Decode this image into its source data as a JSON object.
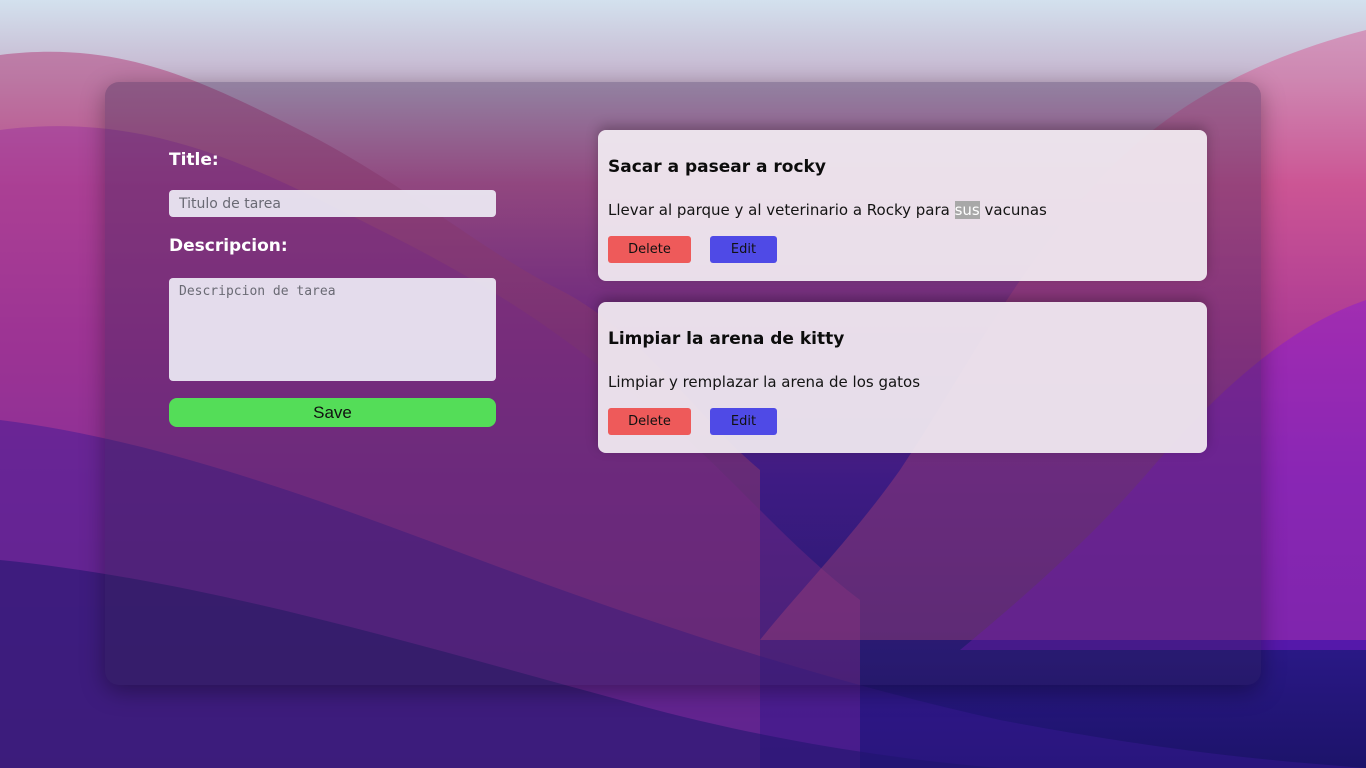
{
  "form": {
    "title_label": "Title:",
    "title_placeholder": "Titulo de tarea",
    "description_label": "Descripcion:",
    "description_placeholder": "Descripcion de tarea",
    "save_label": "Save"
  },
  "tasks": [
    {
      "title": "Sacar a pasear a rocky",
      "description_before": "Llevar al parque y al veterinario a Rocky para ",
      "description_highlight": "sus",
      "description_after": " vacunas",
      "delete_label": "Delete",
      "edit_label": "Edit"
    },
    {
      "title": "Limpiar la arena de kitty",
      "description_before": "Limpiar y remplazar la arena de los gatos",
      "description_highlight": "",
      "description_after": "",
      "delete_label": "Delete",
      "edit_label": "Edit"
    }
  ],
  "colors": {
    "save": "#54dd58",
    "delete": "#ee5a5a",
    "edit": "#4f4ae6"
  }
}
